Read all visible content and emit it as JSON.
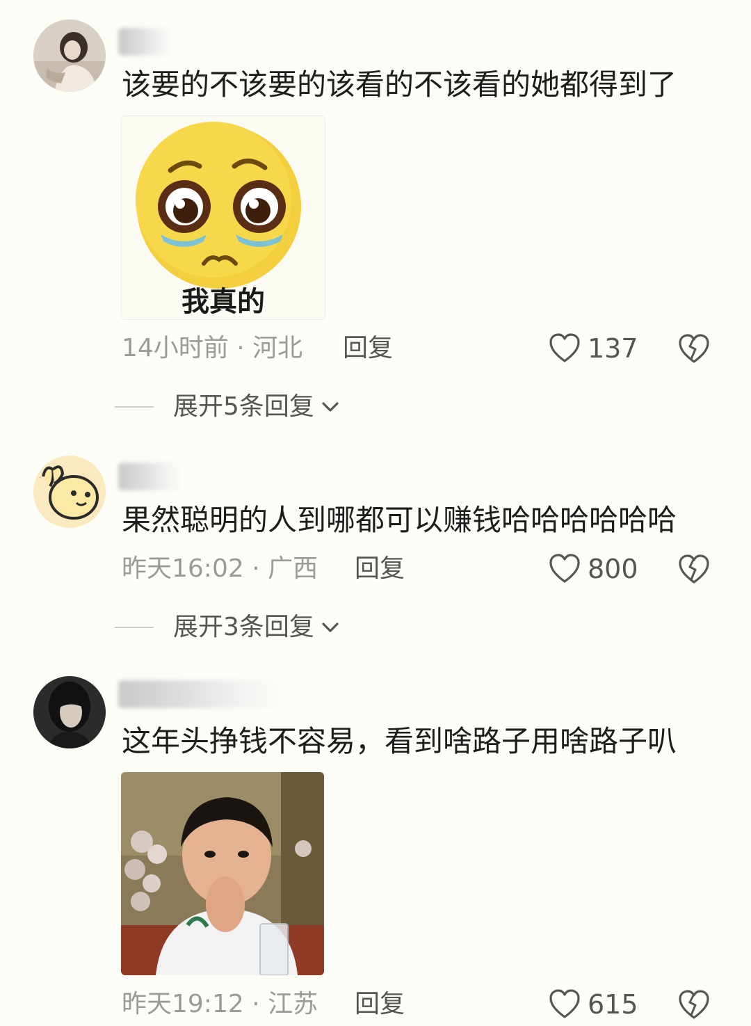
{
  "comments": [
    {
      "text": "该要的不该要的该看的不该看的她都得到了",
      "sticker_caption": "我真的",
      "time_location": "14小时前 · 河北",
      "reply_label": "回复",
      "likes": "137",
      "expand_label": "展开5条回复"
    },
    {
      "text": "果然聪明的人到哪都可以赚钱哈哈哈哈哈哈",
      "time_location": "昨天16:02 · 广西",
      "reply_label": "回复",
      "likes": "800",
      "expand_label": "展开3条回复"
    },
    {
      "text": "这年头挣钱不容易，看到啥路子用啥路子叭",
      "time_location": "昨天19:12 · 江苏",
      "reply_label": "回复",
      "likes": "615"
    }
  ],
  "icons": {
    "like": "heart-outline-icon",
    "dislike": "broken-heart-icon",
    "expand": "chevron-down-icon"
  },
  "colors": {
    "background": "#fdfdf7",
    "meta_text": "#9a9a9a",
    "action_text": "#555555",
    "emoji_yellow": "#f7d84a"
  }
}
